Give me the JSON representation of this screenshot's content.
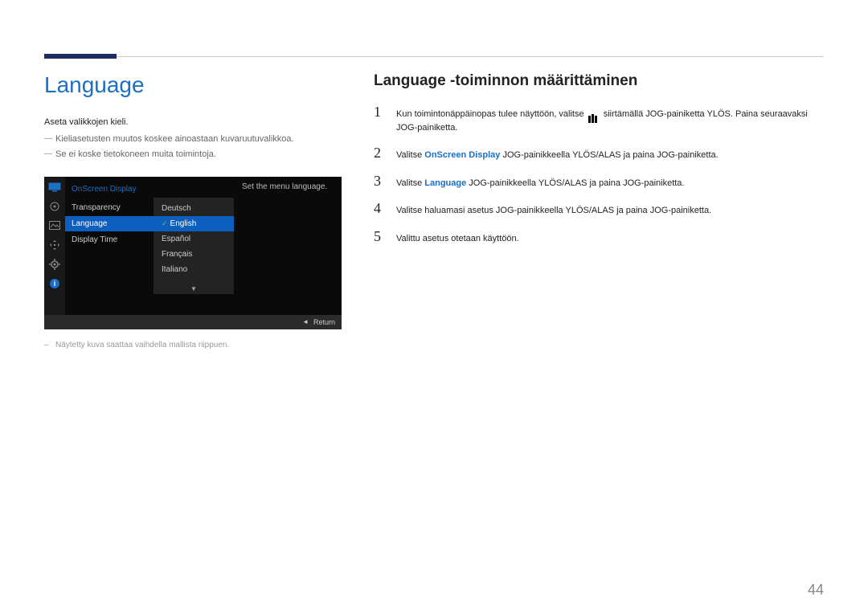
{
  "page_number": "44",
  "left": {
    "title": "Language",
    "intro": "Aseta valikkojen kieli.",
    "notes": [
      "Kieliasetusten muutos koskee ainoastaan kuvaruutuvalikkoa.",
      "Se ei koske tietokoneen muita toimintoja."
    ],
    "footnote": "Näytetty kuva saattaa vaihdella mallista riippuen."
  },
  "osd": {
    "header": "OnScreen Display",
    "menu": [
      {
        "label": "Transparency",
        "selected": false
      },
      {
        "label": "Language",
        "selected": true
      },
      {
        "label": "Display Time",
        "selected": false
      }
    ],
    "options": [
      {
        "label": "Deutsch",
        "selected": false
      },
      {
        "label": "English",
        "selected": true
      },
      {
        "label": "Español",
        "selected": false
      },
      {
        "label": "Français",
        "selected": false
      },
      {
        "label": "Italiano",
        "selected": false
      }
    ],
    "info": "Set the menu language.",
    "footer_return": "Return",
    "sidebar_icons": [
      "monitor-icon",
      "target-icon",
      "image-icon",
      "move-icon",
      "gear-icon",
      "info-icon"
    ]
  },
  "right": {
    "title": "Language -toiminnon määrittäminen",
    "steps": {
      "s1a": "Kun toimintonäppäinopas tulee näyttöön, valitse ",
      "s1b": " siirtämällä JOG-painiketta YLÖS. Paina seuraavaksi JOG-painiketta.",
      "s2a": "Valitse ",
      "s2_hl": "OnScreen Display",
      "s2b": " JOG-painikkeella YLÖS/ALAS ja paina JOG-painiketta.",
      "s3a": "Valitse ",
      "s3_hl": "Language",
      "s3b": " JOG-painikkeella YLÖS/ALAS ja paina JOG-painiketta.",
      "s4": "Valitse haluamasi asetus JOG-painikkeella YLÖS/ALAS ja paina JOG-painiketta.",
      "s5": "Valittu asetus otetaan käyttöön."
    }
  }
}
